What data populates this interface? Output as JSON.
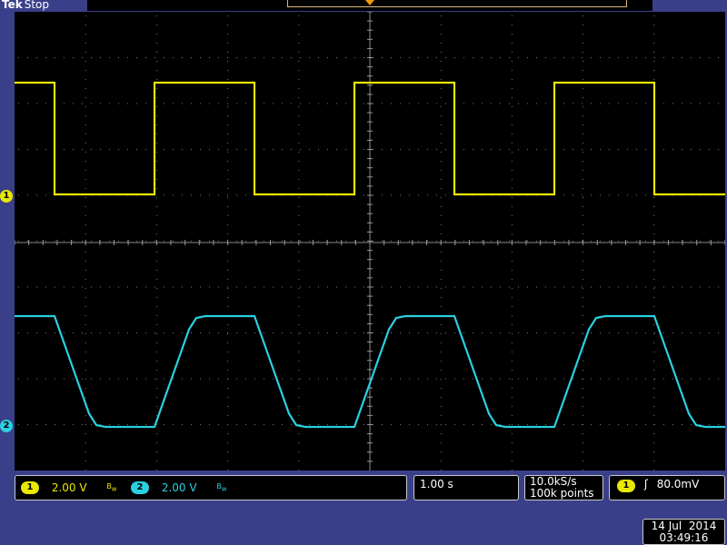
{
  "header": {
    "brand": "Tek",
    "state": "Stop"
  },
  "channels": [
    {
      "marker": "1",
      "scale": "2.00 V",
      "color": "#e8e800"
    },
    {
      "marker": "2",
      "scale": "2.00 V",
      "color": "#2ad0e0"
    }
  ],
  "bandwidth_icon": "bandwidth-limit-icon",
  "timebase": "1.00 s",
  "acquisition": {
    "sample_rate": "10.0kS/s",
    "record_length": "100k points"
  },
  "trigger": {
    "source": "1",
    "slope_icon": "rising-edge-icon",
    "slope_glyph": "ʃ",
    "level": "80.0mV"
  },
  "datetime": {
    "date": "14 Jul  2014",
    "time": "03:49:16"
  },
  "colors": {
    "ch1": "#e8e800",
    "ch2": "#2ad0e0",
    "screen": "#000000",
    "bezel": "#3a3f8a"
  }
}
